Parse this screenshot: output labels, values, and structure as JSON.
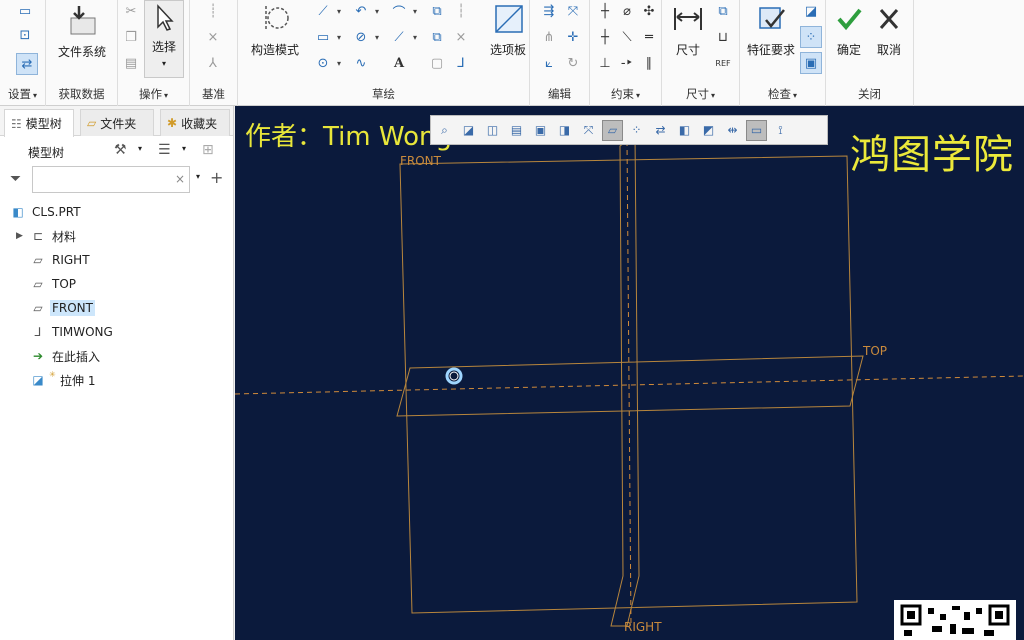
{
  "ribbon": {
    "groups": {
      "settings": "设置",
      "getdata": "获取数据",
      "operations": "操作",
      "datum": "基准",
      "sketch": "草绘",
      "edit": "编辑",
      "constrain": "约束",
      "dimension": "尺寸",
      "inspect": "检查",
      "close": "关闭"
    },
    "buttons": {
      "file_system": "文件系统",
      "select": "选择",
      "construction_mode": "构造模式",
      "palette": "选项板",
      "dimension": "尺寸",
      "feature_req": "特征要求",
      "ok": "确定",
      "cancel": "取消"
    },
    "text_tool": "A"
  },
  "left_panel": {
    "tabs": [
      "模型树",
      "文件夹",
      "收藏夹"
    ],
    "tree_title": "模型树",
    "filter_placeholder": "",
    "tree": [
      {
        "label": "CLS.PRT",
        "icon": "part-icon"
      },
      {
        "label": "材料",
        "icon": "material-icon"
      },
      {
        "label": "RIGHT",
        "icon": "datum-plane-icon"
      },
      {
        "label": "TOP",
        "icon": "datum-plane-icon"
      },
      {
        "label": "FRONT",
        "icon": "datum-plane-icon"
      },
      {
        "label": "TIMWONG",
        "icon": "coordinate-system-icon"
      },
      {
        "label": "在此插入",
        "icon": "insert-here-icon"
      },
      {
        "label": "拉伸 1",
        "icon": "extrude-icon"
      }
    ]
  },
  "viewport": {
    "author": "作者：Tim Wong",
    "brand": "鸿图学院",
    "datums": {
      "front": "FRONT",
      "top": "TOP",
      "right": "RIGHT"
    }
  },
  "colors": {
    "viewport_bg": "#0b1a3c",
    "datum": "#c98a3c",
    "overlay_text": "#ece93a",
    "accent": "#2a6db5",
    "ok_green": "#2e9e3e"
  }
}
